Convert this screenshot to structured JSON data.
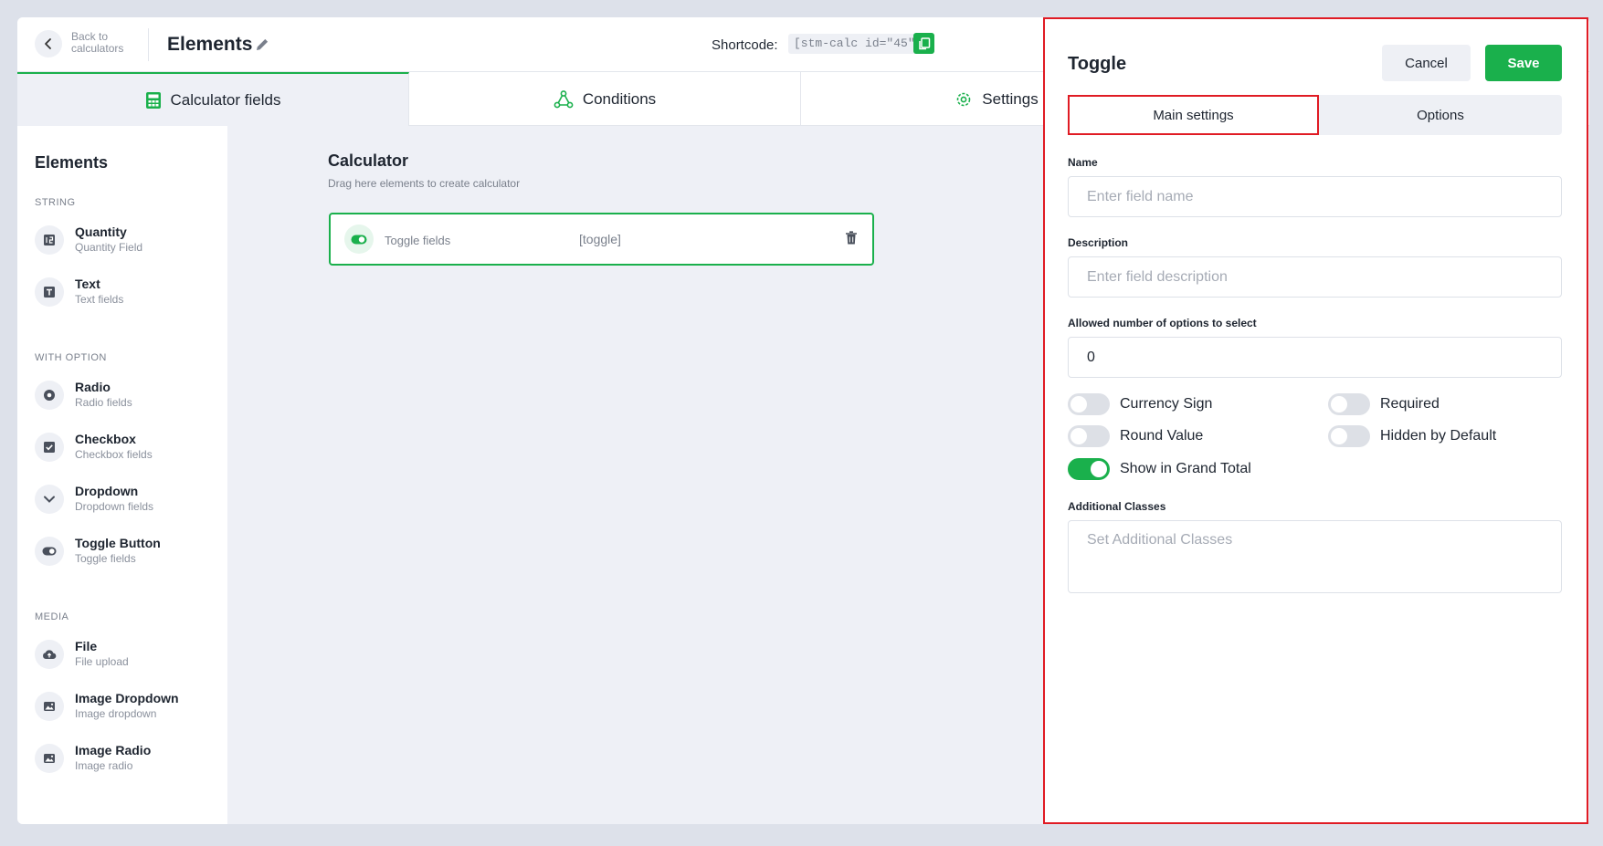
{
  "header": {
    "back_label": "Back to calculators",
    "title": "Elements",
    "shortcode_label": "Shortcode:",
    "shortcode_value": "[stm-calc id=\"45\"]"
  },
  "tabs": [
    {
      "label": "Calculator fields",
      "icon": "calculator-icon",
      "active": true
    },
    {
      "label": "Conditions",
      "icon": "conditions-icon",
      "active": false
    },
    {
      "label": "Settings",
      "icon": "gear-icon",
      "active": false
    }
  ],
  "sidebar": {
    "title": "Elements",
    "sections": {
      "string": "STRING",
      "with_option": "WITH OPTION",
      "media": "MEDIA"
    },
    "items": [
      {
        "name": "Quantity",
        "sub": "Quantity Field",
        "icon": "quantity-icon"
      },
      {
        "name": "Text",
        "sub": "Text fields",
        "icon": "text-icon"
      },
      {
        "name": "Radio",
        "sub": "Radio fields",
        "icon": "radio-icon"
      },
      {
        "name": "Checkbox",
        "sub": "Checkbox fields",
        "icon": "checkbox-icon"
      },
      {
        "name": "Dropdown",
        "sub": "Dropdown fields",
        "icon": "dropdown-icon"
      },
      {
        "name": "Toggle Button",
        "sub": "Toggle fields",
        "icon": "toggle-icon"
      },
      {
        "name": "File",
        "sub": "File upload",
        "icon": "upload-icon"
      },
      {
        "name": "Image Dropdown",
        "sub": "Image dropdown",
        "icon": "image-icon"
      },
      {
        "name": "Image Radio",
        "sub": "Image radio",
        "icon": "image-icon"
      }
    ]
  },
  "canvas": {
    "title": "Calculator",
    "hint": "Drag here elements to create calculator",
    "field": {
      "label": "Toggle fields",
      "code": "[toggle]"
    }
  },
  "panel": {
    "title": "Toggle",
    "cancel_label": "Cancel",
    "save_label": "Save",
    "tabs": {
      "main": "Main settings",
      "options": "Options"
    },
    "name": {
      "label": "Name",
      "placeholder": "Enter field name"
    },
    "description": {
      "label": "Description",
      "placeholder": "Enter field description"
    },
    "allowed": {
      "label": "Allowed number of options to select",
      "value": "0"
    },
    "switches": [
      {
        "label": "Currency Sign",
        "on": false
      },
      {
        "label": "Required",
        "on": false
      },
      {
        "label": "Round Value",
        "on": false
      },
      {
        "label": "Hidden by Default",
        "on": false
      },
      {
        "label": "Show in Grand Total",
        "on": true
      }
    ],
    "classes": {
      "label": "Additional Classes",
      "placeholder": "Set Additional Classes"
    }
  },
  "colors": {
    "accent": "#1ab04c",
    "highlight": "#e01b24"
  }
}
